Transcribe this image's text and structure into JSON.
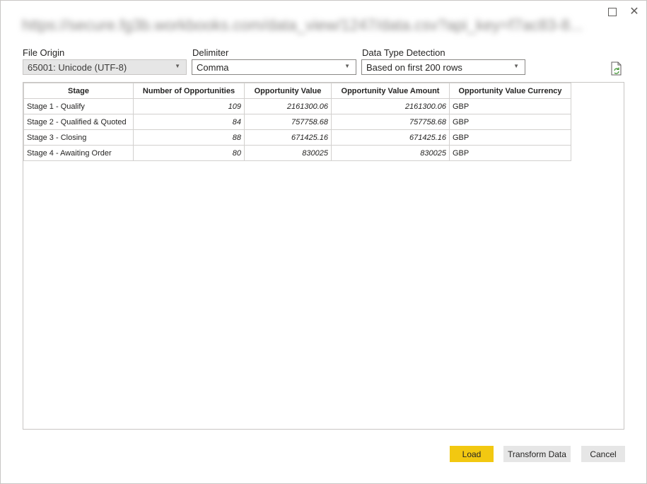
{
  "dialog": {
    "title_blurred": "https://secure.fg3b.workbooks.com/data_view/1247/data.csv?api_key=f7ac83-8..."
  },
  "options": {
    "file_origin": {
      "label": "File Origin",
      "value": "65001: Unicode (UTF-8)"
    },
    "delimiter": {
      "label": "Delimiter",
      "value": "Comma"
    },
    "data_type_detection": {
      "label": "Data Type Detection",
      "value": "Based on first 200 rows"
    }
  },
  "table": {
    "columns": [
      "Stage",
      "Number of Opportunities",
      "Opportunity Value",
      "Opportunity Value Amount",
      "Opportunity Value Currency"
    ],
    "rows": [
      [
        "Stage 1 - Qualify",
        "109",
        "2161300.06",
        "2161300.06",
        "GBP"
      ],
      [
        "Stage 2 - Qualified & Quoted",
        "84",
        "757758.68",
        "757758.68",
        "GBP"
      ],
      [
        "Stage 3 - Closing",
        "88",
        "671425.16",
        "671425.16",
        "GBP"
      ],
      [
        "Stage 4 - Awaiting Order",
        "80",
        "830025",
        "830025",
        "GBP"
      ]
    ]
  },
  "buttons": {
    "load": "Load",
    "transform": "Transform Data",
    "cancel": "Cancel"
  },
  "colors": {
    "accent": "#f2c811",
    "secondary_button": "#e6e6e6"
  }
}
